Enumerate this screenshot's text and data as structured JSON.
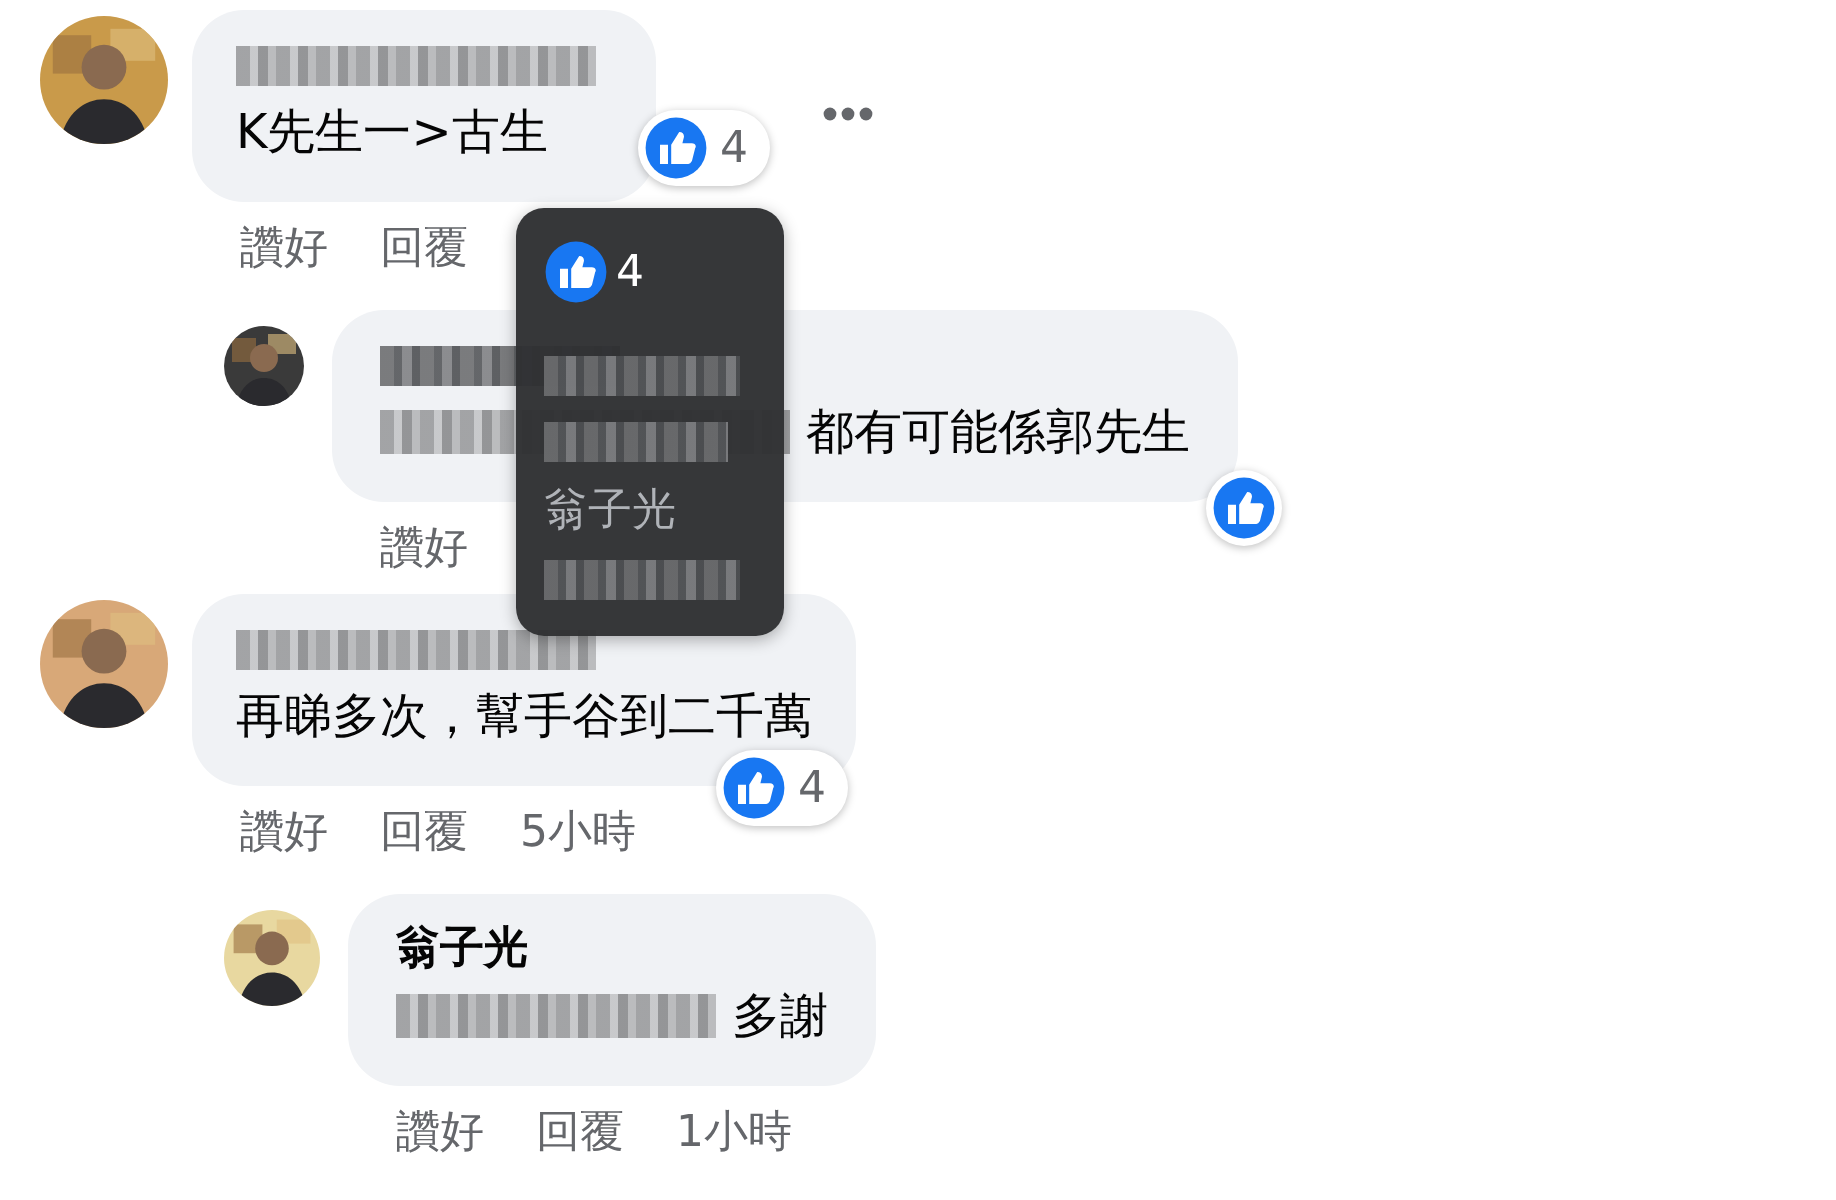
{
  "comments": [
    {
      "author": {
        "kind": "blurred"
      },
      "body": [
        {
          "kind": "text",
          "text": "K先生一>古生"
        }
      ],
      "reaction": {
        "kind": "like",
        "count": "4"
      },
      "actions": [
        "讚好",
        "回覆"
      ],
      "replies": [
        {
          "author": {
            "kind": "blurred"
          },
          "body": [
            {
              "kind": "blurred"
            },
            {
              "kind": "text",
              "text": "都有可能係郭先生"
            }
          ],
          "reaction": {
            "kind": "like"
          },
          "actions": [
            "讚好"
          ]
        }
      ]
    },
    {
      "author": {
        "kind": "blurred"
      },
      "body": [
        {
          "kind": "text",
          "text": "再睇多次，幫手谷到二千萬"
        }
      ],
      "reaction": {
        "kind": "like",
        "count": "4"
      },
      "actions": [
        "讚好",
        "回覆"
      ],
      "time": "5小時",
      "replies": [
        {
          "author": {
            "kind": "text",
            "text": "翁子光"
          },
          "body": [
            {
              "kind": "blurred"
            },
            {
              "kind": "text",
              "text": "多謝"
            }
          ],
          "actions": [
            "讚好",
            "回覆"
          ],
          "time": "1小時"
        }
      ]
    }
  ],
  "tooltip": {
    "count": "4",
    "people": [
      {
        "kind": "blurred"
      },
      {
        "kind": "blurred"
      },
      {
        "kind": "text",
        "text": "翁子光"
      },
      {
        "kind": "blurred"
      }
    ]
  }
}
